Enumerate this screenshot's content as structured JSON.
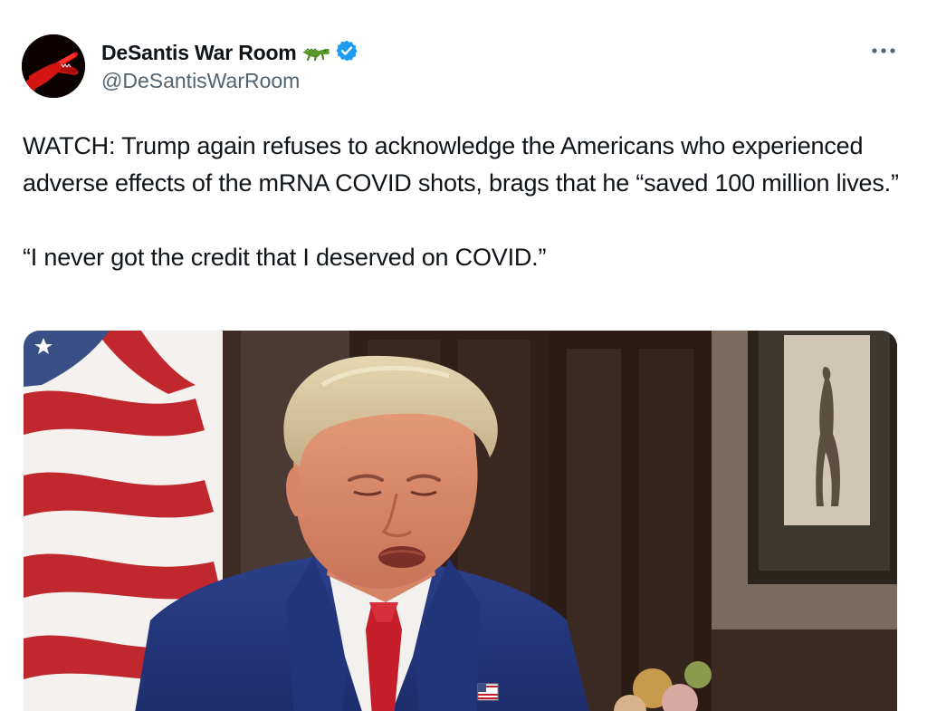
{
  "author": {
    "display_name": "DeSantis War Room",
    "handle": "@DeSantisWarRoom",
    "avatar_icon": "red-alligator-avatar",
    "name_emoji_icon": "alligator-icon",
    "verified_icon": "verified-badge-icon",
    "verified_color": "#1d9bf0"
  },
  "menu": {
    "more_icon": "more-options-icon"
  },
  "tweet": {
    "text": "WATCH: Trump again refuses to acknowledge the Americans who experienced adverse effects of the mRNA COVID shots, brags that he “saved 100 million lives.”\n\n“I never got the credit that I deserved on COVID.”"
  },
  "media": {
    "type": "video-thumbnail",
    "scene": "man in navy suit and red tie seated in interview, American flag at left, framed golf picture at right"
  },
  "colors": {
    "text": "#0f1419",
    "secondary_text": "#536471",
    "accent": "#1d9bf0"
  }
}
